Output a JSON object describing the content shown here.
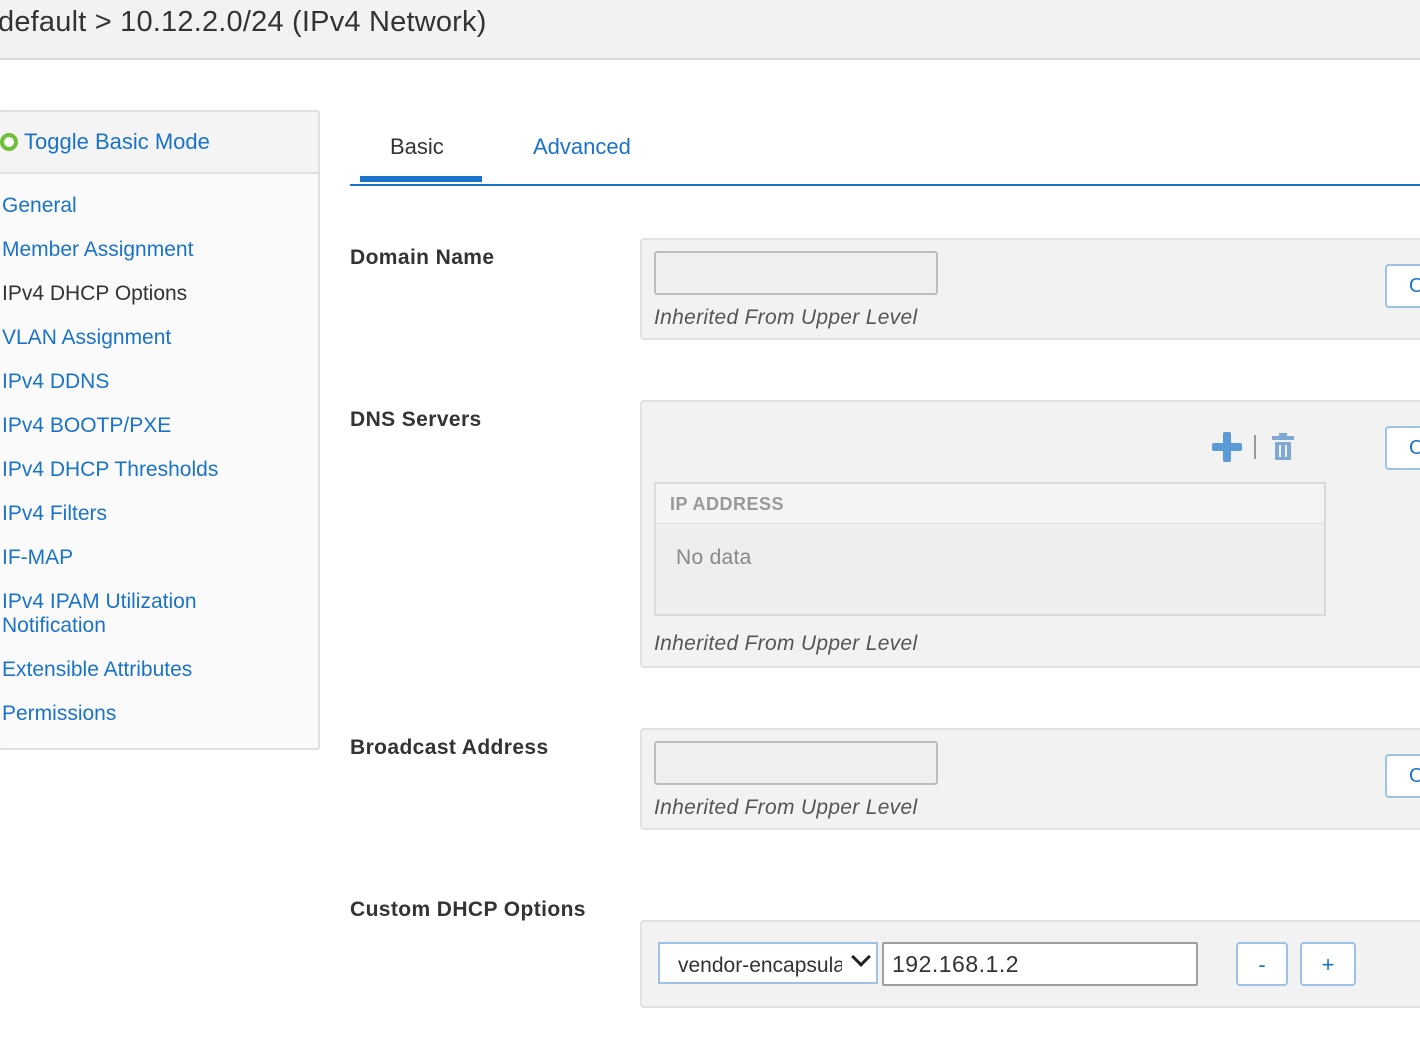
{
  "header": {
    "breadcrumb": "default > 10.12.2.0/24 (IPv4 Network)"
  },
  "sidebar": {
    "toggle_label": "Toggle Basic Mode",
    "items": [
      {
        "label": "General"
      },
      {
        "label": "Member Assignment"
      },
      {
        "label": "IPv4 DHCP Options"
      },
      {
        "label": "VLAN Assignment"
      },
      {
        "label": "IPv4 DDNS"
      },
      {
        "label": "IPv4 BOOTP/PXE"
      },
      {
        "label": "IPv4 DHCP Thresholds"
      },
      {
        "label": "IPv4 Filters"
      },
      {
        "label": "IF-MAP"
      },
      {
        "label": "IPv4 IPAM Utilization Notification"
      },
      {
        "label": "Extensible Attributes"
      },
      {
        "label": "Permissions"
      }
    ],
    "active_item": "IPv4 DHCP Options"
  },
  "tabs": {
    "basic": "Basic",
    "advanced": "Advanced",
    "selected": "Basic"
  },
  "form": {
    "domain_name": {
      "label": "Domain Name",
      "value": "",
      "inherited_text": "Inherited From Upper Level",
      "override_label": "O"
    },
    "dns_servers": {
      "label": "DNS Servers",
      "column_header": "IP ADDRESS",
      "empty_text": "No data",
      "inherited_text": "Inherited From Upper Level",
      "override_label": "O"
    },
    "broadcast_address": {
      "label": "Broadcast Address",
      "value": "",
      "inherited_text": "Inherited From Upper Level",
      "override_label": "O"
    },
    "custom_dhcp_options": {
      "label": "Custom DHCP Options",
      "option_name": "vendor-encapsulated-options",
      "option_value": "192.168.1.2",
      "remove_label": "-",
      "add_label": "+"
    }
  },
  "colors": {
    "link": "#1a73c9",
    "toggle_on": "#6fbf3a",
    "panel_bg": "#f2f2f2"
  }
}
